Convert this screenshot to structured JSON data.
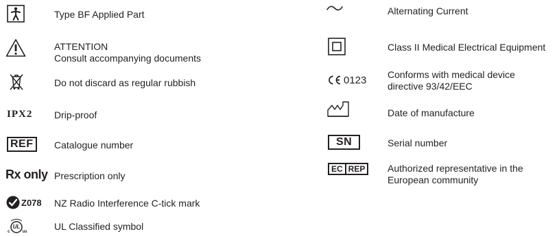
{
  "left": [
    {
      "symbol": "bf-applied-part",
      "text": "Type BF Applied Part"
    },
    {
      "symbol": "attention",
      "text": "ATTENTION",
      "text2": "Consult accompanying documents"
    },
    {
      "symbol": "weee-bin",
      "text": "Do not discard as regular rubbish"
    },
    {
      "symbol_text": "IPX2",
      "text": "Drip-proof"
    },
    {
      "symbol_text": "REF",
      "text": "Catalogue number"
    },
    {
      "symbol_text": "Rx only",
      "text": "Prescription only"
    },
    {
      "symbol_text": "Z078",
      "text": "NZ Radio Interference C-tick mark"
    },
    {
      "symbol": "ul-classified",
      "symbol_text": "UL",
      "text": "UL Classified symbol"
    }
  ],
  "right": [
    {
      "symbol": "alternating-current",
      "text": "Alternating Current"
    },
    {
      "symbol": "class-ii",
      "text": "Class II Medical Electrical Equipment"
    },
    {
      "symbol_text": "0123",
      "text": "Conforms with medical device",
      "text2": "directive 93/42/EEC"
    },
    {
      "symbol": "manufacture-date",
      "text": "Date of manufacture"
    },
    {
      "symbol_text": "SN",
      "text": "Serial number"
    },
    {
      "symbol_text_a": "EC",
      "symbol_text_b": "REP",
      "text": "Authorized representative in the",
      "text2": "European community"
    }
  ]
}
